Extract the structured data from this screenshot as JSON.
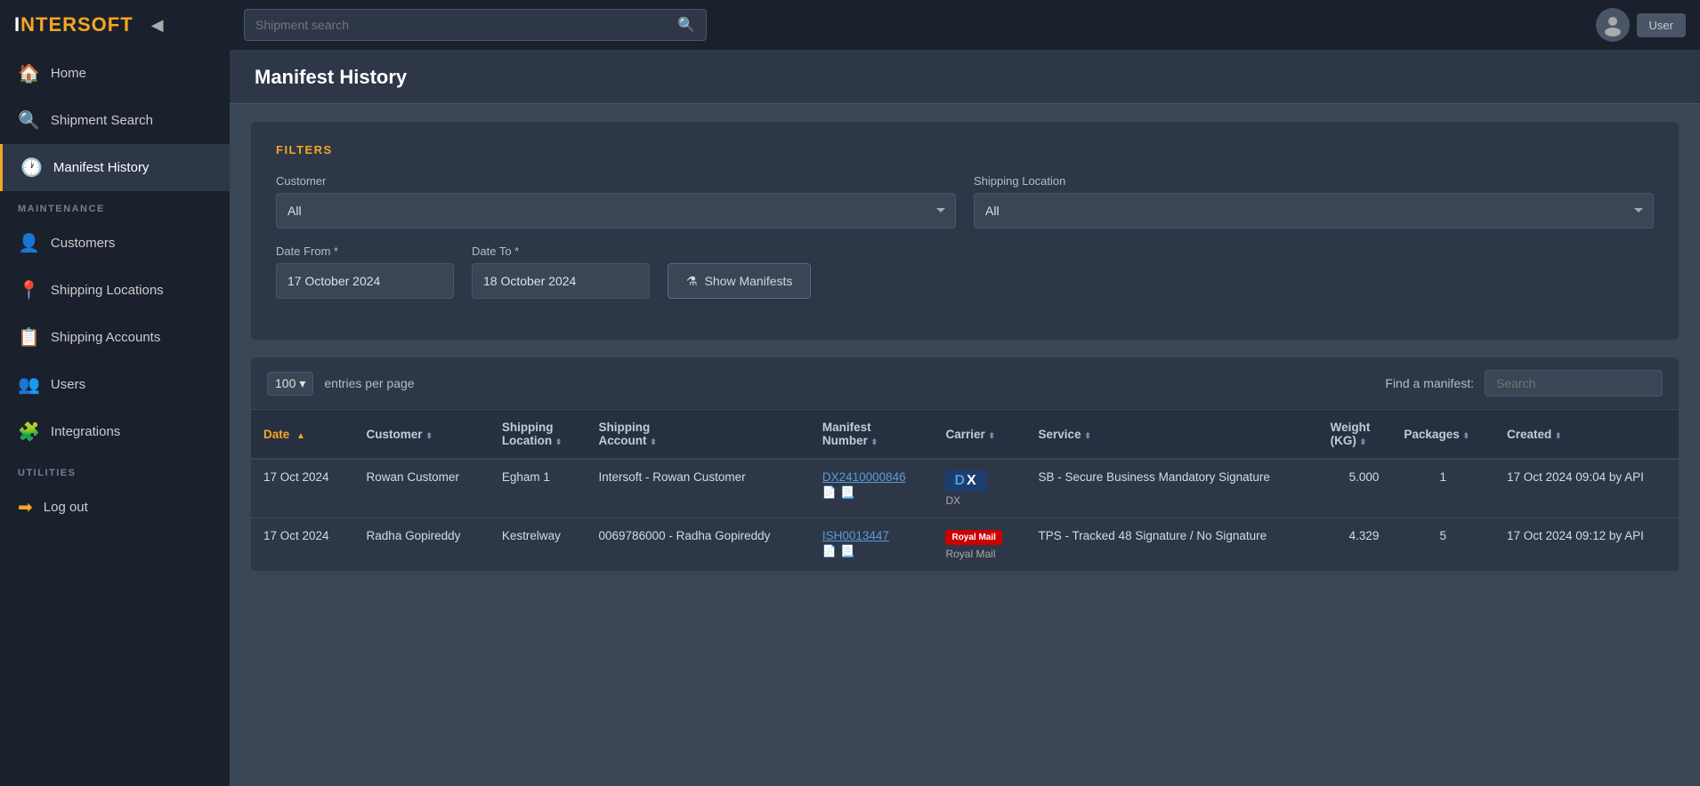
{
  "app": {
    "logo_white": "I",
    "logo_orange": "NTERSOFT",
    "search_placeholder": "Shipment search",
    "user_name": "User"
  },
  "sidebar": {
    "items": [
      {
        "id": "home",
        "label": "Home",
        "icon": "🏠",
        "active": false
      },
      {
        "id": "shipment-search",
        "label": "Shipment Search",
        "icon": "🔍",
        "active": false
      },
      {
        "id": "manifest-history",
        "label": "Manifest History",
        "icon": "🕐",
        "active": true
      }
    ],
    "maintenance_label": "MAINTENANCE",
    "maintenance_items": [
      {
        "id": "customers",
        "label": "Customers",
        "icon": "👤"
      },
      {
        "id": "shipping-locations",
        "label": "Shipping Locations",
        "icon": "📍"
      },
      {
        "id": "shipping-accounts",
        "label": "Shipping Accounts",
        "icon": "📋"
      },
      {
        "id": "users",
        "label": "Users",
        "icon": "👥"
      },
      {
        "id": "integrations",
        "label": "Integrations",
        "icon": "🧩"
      }
    ],
    "utilities_label": "UTILITIES",
    "utilities_items": [
      {
        "id": "logout",
        "label": "Log out",
        "icon": "➡"
      }
    ]
  },
  "page": {
    "title": "Manifest History"
  },
  "filters": {
    "section_label": "FILTERS",
    "customer_label": "Customer",
    "customer_value": "All",
    "customer_options": [
      "All"
    ],
    "shipping_location_label": "Shipping Location",
    "shipping_location_value": "All",
    "shipping_location_options": [
      "All"
    ],
    "date_from_label": "Date From *",
    "date_from_value": "17 October 2024",
    "date_to_label": "Date To *",
    "date_to_value": "18 October 2024",
    "show_manifests_label": "Show Manifests"
  },
  "table": {
    "entries_value": "100",
    "entries_label": "entries per page",
    "find_label": "Find a manifest:",
    "find_placeholder": "Search",
    "columns": [
      "Date",
      "Customer",
      "Shipping Location",
      "Shipping Account",
      "Manifest Number",
      "Carrier",
      "Service",
      "Weight (KG)",
      "Packages",
      "Created"
    ],
    "rows": [
      {
        "date": "17 Oct 2024",
        "customer": "Rowan Customer",
        "shipping_location": "Egham 1",
        "shipping_account": "Intersoft - Rowan Customer",
        "manifest_number": "DX2410000846",
        "carrier_code": "DX",
        "carrier_name": "DX",
        "service": "SB - Secure Business Mandatory Signature",
        "weight": "5.000",
        "packages": "1",
        "created": "17 Oct 2024 09:04 by API"
      },
      {
        "date": "17 Oct 2024",
        "customer": "Radha Gopireddy",
        "shipping_location": "Kestrelway",
        "shipping_account": "0069786000 - Radha Gopireddy",
        "manifest_number": "ISH0013447",
        "carrier_code": "RM",
        "carrier_name": "Royal Mail",
        "service": "TPS - Tracked 48 Signature / No Signature",
        "weight": "4.329",
        "packages": "5",
        "created": "17 Oct 2024 09:12 by API"
      }
    ]
  }
}
